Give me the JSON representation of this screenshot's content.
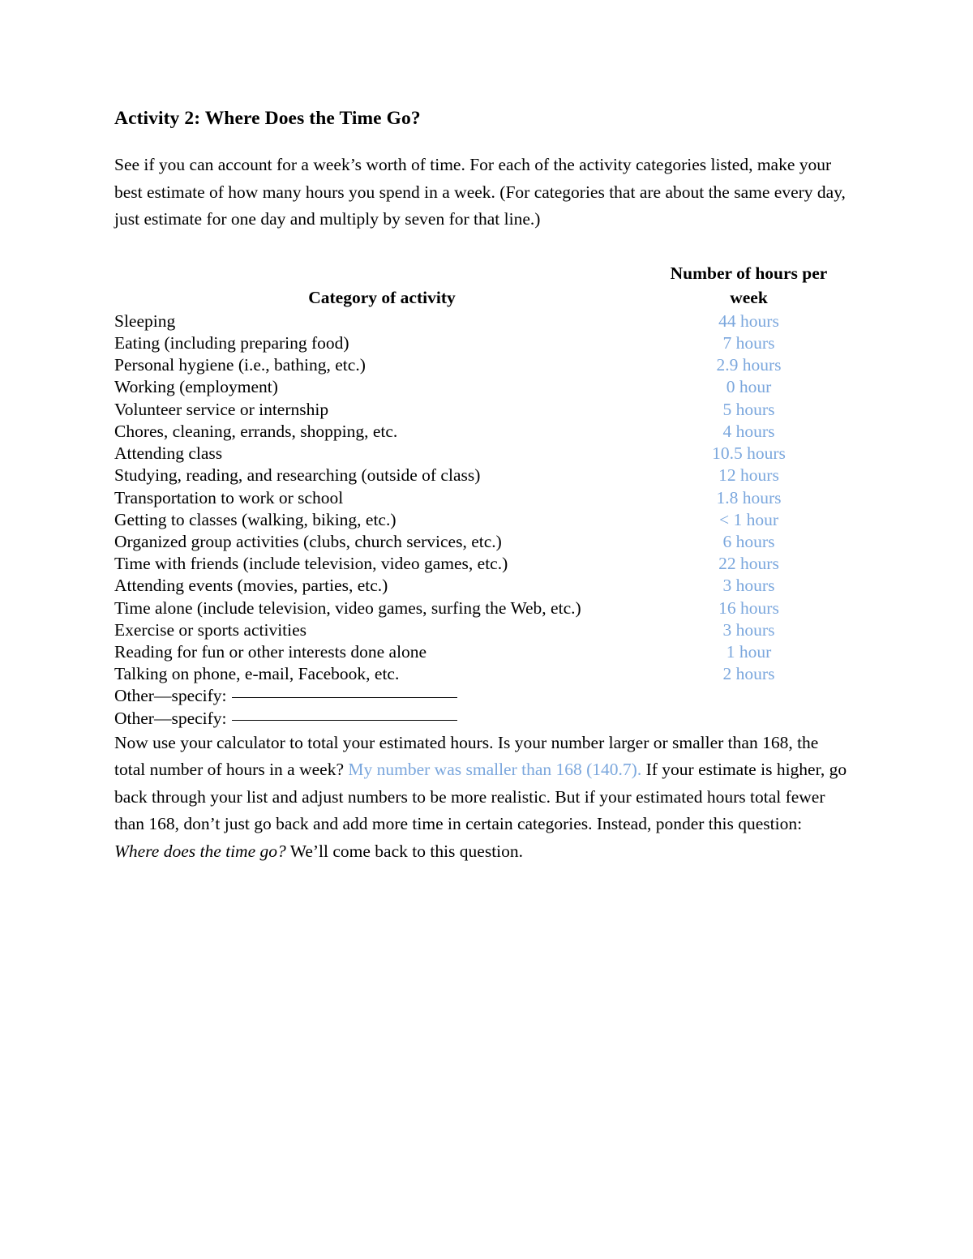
{
  "document": {
    "title": "Activity 2: Where Does the Time Go?",
    "intro": "See if you can account for a week’s worth of time. For each of the activity categories listed, make your best estimate of how many hours you spend in a week. (For categories that are about the same every day, just estimate for one day and multiply by seven for that line.)"
  },
  "table": {
    "headers": {
      "category": "Category of activity",
      "hours": "Number of hours per week"
    },
    "rows": [
      {
        "label": "Sleeping",
        "hours": "44 hours"
      },
      {
        "label": "Eating (including preparing food)",
        "hours": "7 hours"
      },
      {
        "label": "Personal hygiene (i.e., bathing, etc.)",
        "hours": "2.9 hours"
      },
      {
        "label": "Working (employment)",
        "hours": "0 hour"
      },
      {
        "label": "Volunteer service or internship",
        "hours": "5 hours"
      },
      {
        "label": "Chores, cleaning, errands, shopping, etc.",
        "hours": "4 hours"
      },
      {
        "label": "Attending class",
        "hours": "10.5 hours"
      },
      {
        "label": "Studying, reading, and researching (outside of class)",
        "hours": "12 hours"
      },
      {
        "label": "Transportation to work or school",
        "hours": "1.8 hours"
      },
      {
        "label": "Getting to classes (walking, biking, etc.)",
        "hours": "< 1 hour"
      },
      {
        "label": "Organized group activities (clubs, church services, etc.)",
        "hours": "6 hours"
      },
      {
        "label": "Time with friends (include television, video games, etc.)",
        "hours": "22 hours"
      },
      {
        "label": "Attending events (movies, parties, etc.)",
        "hours": "3 hours"
      },
      {
        "label": "Time alone (include television, video games, surfing the Web, etc.)",
        "hours": "16 hours"
      },
      {
        "label": "Exercise or sports activities",
        "hours": "3 hours"
      },
      {
        "label": "Reading for fun or other interests done alone",
        "hours": "1 hour"
      },
      {
        "label": "Talking on phone, e-mail, Facebook, etc.",
        "hours": "2 hours"
      }
    ],
    "other_rows": [
      {
        "label": "Other—specify:",
        "value": ""
      },
      {
        "label": "Other—specify:",
        "value": ""
      }
    ]
  },
  "closing": {
    "part1": "Now use your calculator to total your estimated hours. Is your number larger or smaller than 168, the total number of hours in a week? ",
    "answer": "My number was smaller than 168 (140.7).",
    "part2": " If your estimate is higher, go back through your list and adjust numbers to be more realistic. But if your estimated hours total fewer than 168, don’t just go back and add more time in certain categories. Instead, ponder this question: ",
    "question": "Where does the time go?",
    "part3": " We’ll come back to this question."
  },
  "colors": {
    "answer_blue": "#7ba7dd",
    "text_black": "#000000",
    "page_background": "#ffffff"
  }
}
